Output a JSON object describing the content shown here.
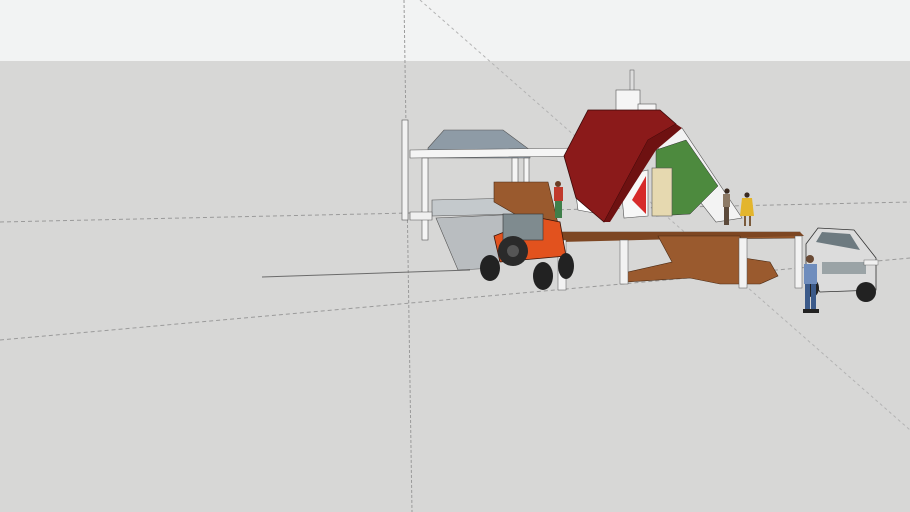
{
  "viewport": {
    "sky_color": "#f2f3f3",
    "ground_color": "#d7d7d6",
    "axis_line_color": "#9a9a9a"
  },
  "model": {
    "roof_color": "#8b1a1a",
    "deck_color": "#9a5a2e",
    "pergola_roof_color": "#8e9ba6",
    "jeep_color": "#e2521e",
    "suv_color": "#dcdcdc",
    "glass_color": "#4d8a3e",
    "accent_color": "#d62a2a"
  }
}
